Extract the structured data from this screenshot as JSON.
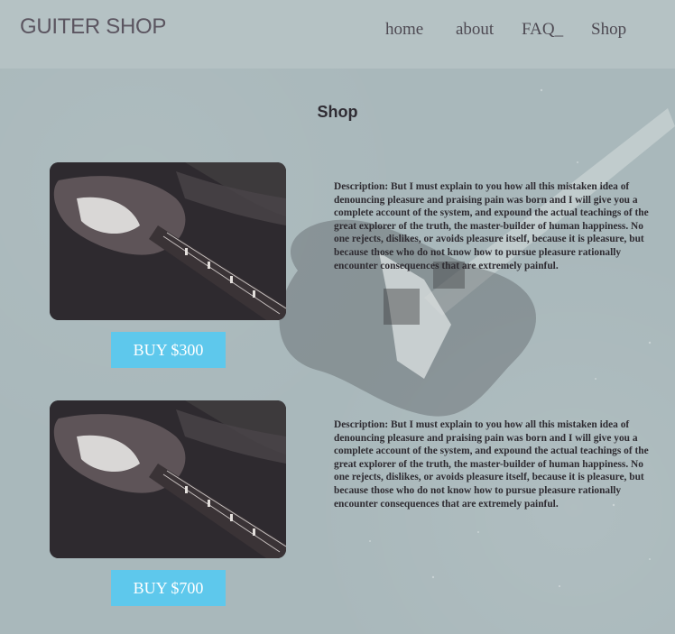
{
  "header": {
    "logo": "GUITER SHOP",
    "nav": [
      {
        "label": "home"
      },
      {
        "label": "about"
      },
      {
        "label": "FAQ_"
      },
      {
        "label": "Shop"
      }
    ]
  },
  "main": {
    "title": "Shop",
    "products": [
      {
        "buy_label": "BUY $300",
        "description": "Description: But I must explain to you how all this mistaken idea of denouncing pleasure and praising pain was born and I will give you a complete account of the system, and expound the actual teachings of the great explorer of the truth, the master-builder of human happiness. No one rejects, dislikes, or avoids pleasure itself, because it is pleasure, but because those who do not know how to pursue pleasure rationally encounter consequences that are extremely painful."
      },
      {
        "buy_label": "BUY $700",
        "description": "Description: But I must explain to you how all this mistaken idea of denouncing pleasure and praising pain was born and I will give you a complete account of the system, and expound the actual teachings of the great explorer of the truth, the master-builder of human happiness. No one rejects, dislikes, or avoids pleasure itself, because it is pleasure, but because those who do not know how to pursue pleasure rationally encounter consequences that are extremely painful."
      }
    ]
  },
  "colors": {
    "background": "#a9b8bb",
    "header": "#b5c2c4",
    "button": "#5ec8ec",
    "button_text": "#ffffff"
  }
}
